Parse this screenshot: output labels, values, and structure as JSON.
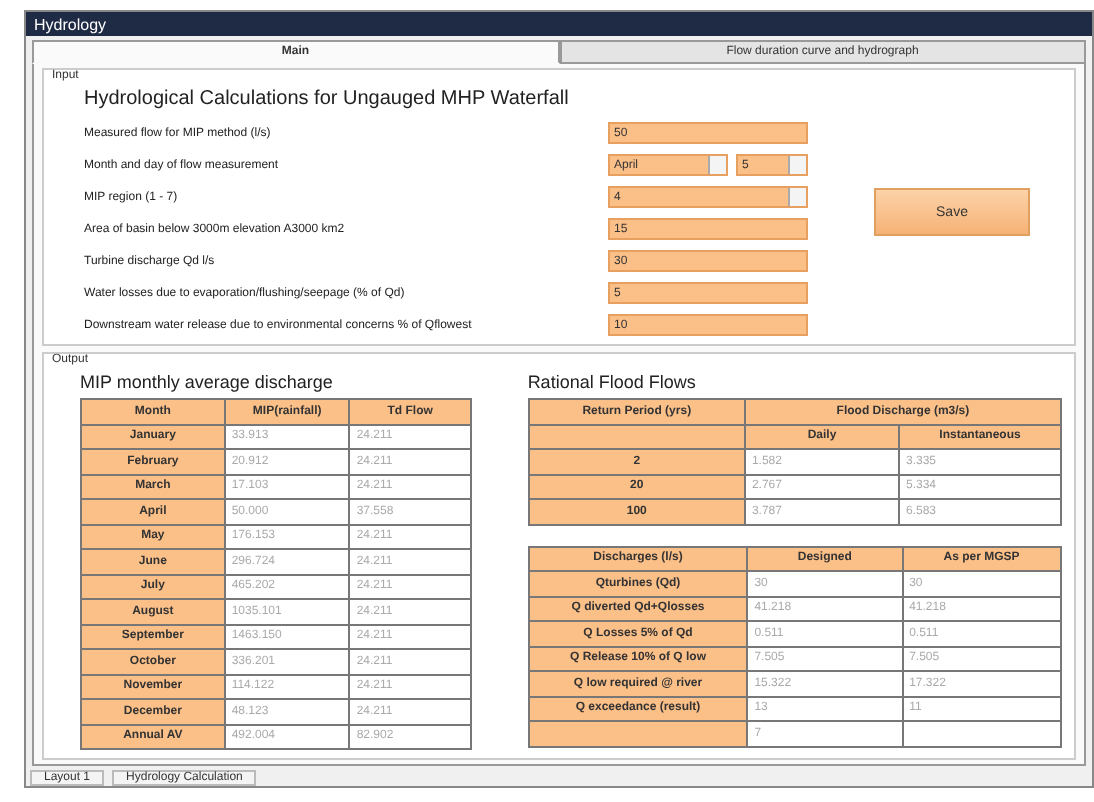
{
  "window": {
    "title": "Hydrology"
  },
  "tabs": [
    {
      "label": "Main",
      "selected": true
    },
    {
      "label": "Flow duration curve and hydrograph",
      "selected": false
    }
  ],
  "input": {
    "group_title": "Input",
    "heading": "Hydrological Calculations for Ungauged MHP Waterfall",
    "fields": [
      {
        "label": "Measured flow for MIP method (l/s)",
        "kind": "text",
        "values": [
          "50"
        ]
      },
      {
        "label": "Month and day of flow measurement",
        "kind": "dropdowns",
        "values": [
          "April",
          "5"
        ]
      },
      {
        "label": "MIP region (1 - 7)",
        "kind": "dropdown",
        "values": [
          "4"
        ]
      },
      {
        "label": "Area of basin below 3000m elevation A3000 km2",
        "kind": "text",
        "values": [
          "15"
        ]
      },
      {
        "label": "Turbine discharge Qd l/s",
        "kind": "text",
        "values": [
          "30"
        ]
      },
      {
        "label": "Water losses due to evaporation/flushing/seepage (% of Qd)",
        "kind": "text",
        "values": [
          "5"
        ]
      },
      {
        "label": "Downstream water release due to environmental concerns % of Qflowest",
        "kind": "text",
        "values": [
          "10"
        ]
      }
    ],
    "button": "Save"
  },
  "output": {
    "group_title": "Output",
    "monthly": {
      "title": "MIP monthly average discharge",
      "columns": [
        "Month",
        "MIP(rainfall)",
        "Td Flow"
      ],
      "rows": [
        [
          "January",
          "33.913",
          "24.211"
        ],
        [
          "February",
          "20.912",
          "24.211"
        ],
        [
          "March",
          "17.103",
          "24.211"
        ],
        [
          "April",
          "50.000",
          "37.558"
        ],
        [
          "May",
          "176.153",
          "24.211"
        ],
        [
          "June",
          "296.724",
          "24.211"
        ],
        [
          "July",
          "465.202",
          "24.211"
        ],
        [
          "August",
          "1035.101",
          "24.211"
        ],
        [
          "September",
          "1463.150",
          "24.211"
        ],
        [
          "October",
          "336.201",
          "24.211"
        ],
        [
          "November",
          "114.122",
          "24.211"
        ],
        [
          "December",
          "48.123",
          "24.211"
        ],
        [
          "Annual AV",
          "492.004",
          "82.902"
        ]
      ]
    },
    "flood": {
      "title": "Rational Flood Flows",
      "header_rows": [
        [
          {
            "text": "Return Period (yrs)"
          },
          {
            "text": "Flood Discharge (m3/s)",
            "colspan": 2
          }
        ],
        [
          null,
          {
            "text": "Daily"
          },
          {
            "text": "Instantaneous"
          }
        ]
      ],
      "rows": [
        [
          "2",
          "1.582",
          "3.335"
        ],
        [
          "20",
          "2.767",
          "5.334"
        ],
        [
          "100",
          "3.787",
          "6.583"
        ]
      ]
    },
    "discharges": {
      "columns": [
        "Discharges (l/s)",
        "Designed",
        "As per MGSP"
      ],
      "rows": [
        [
          "Qturbines (Qd)",
          "30",
          "30"
        ],
        [
          "Q diverted Qd+Qlosses",
          "41.218",
          "41.218"
        ],
        [
          "Q Losses 5% of Qd",
          "0.511",
          "0.511"
        ],
        [
          "Q Release 10% of Q low",
          "7.505",
          "7.505"
        ],
        [
          "Q low required @ river",
          "15.322",
          "17.322"
        ],
        [
          "Q exceedance (result)",
          "13",
          "11"
        ],
        [
          null,
          "7",
          null
        ]
      ]
    }
  },
  "status_bar": [
    "Layout 1",
    "Hydrology Calculation"
  ]
}
